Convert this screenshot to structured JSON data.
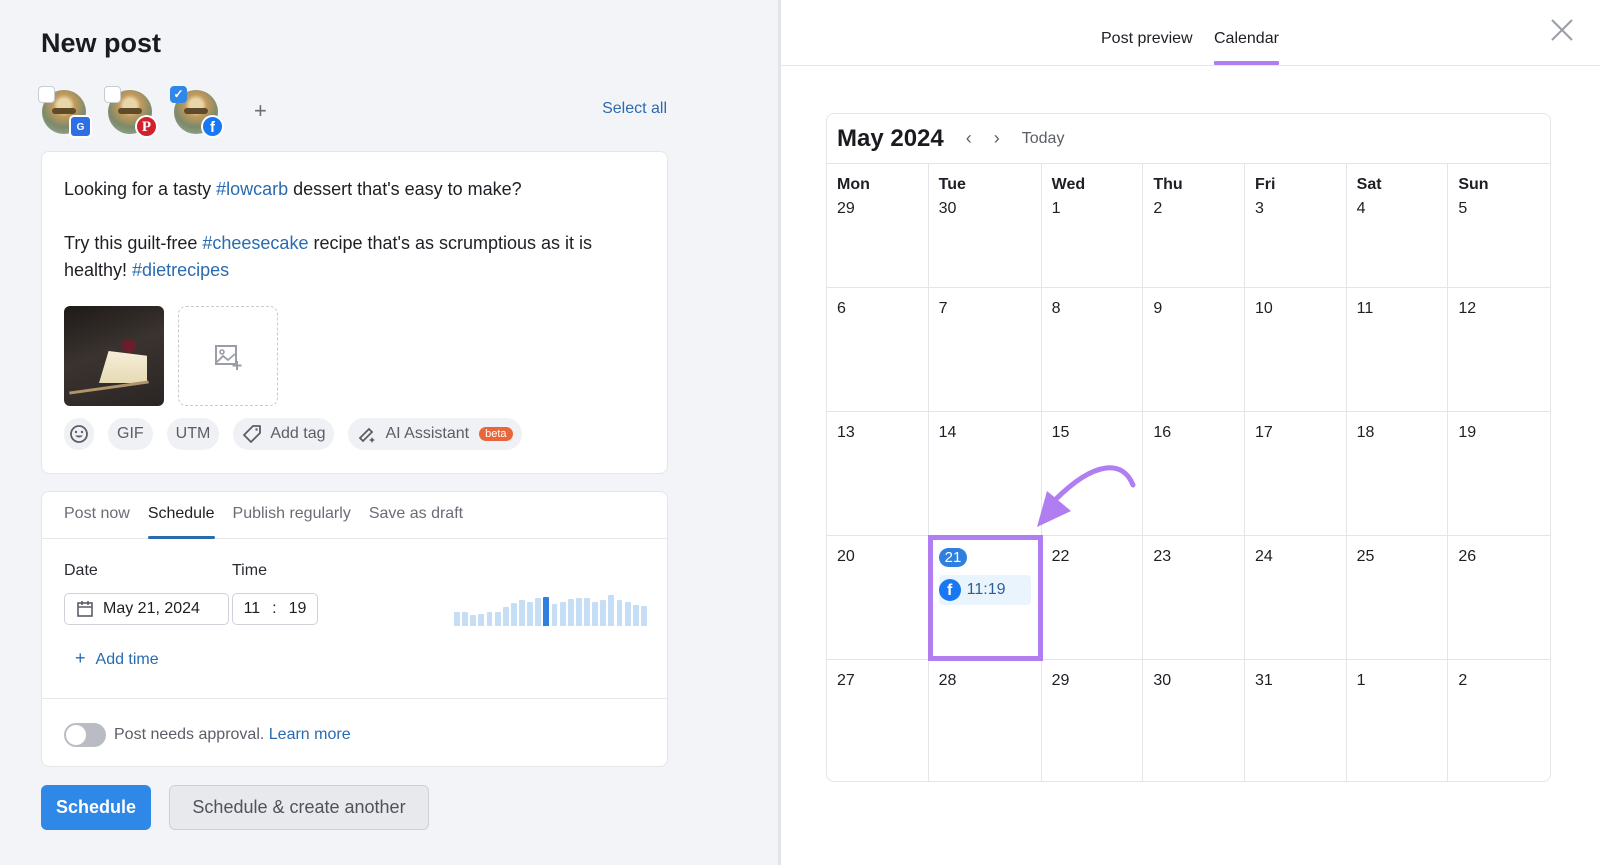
{
  "left": {
    "title": "New post",
    "accounts": [
      {
        "network": "google-business-profile",
        "checked": false,
        "badge": "G"
      },
      {
        "network": "pinterest",
        "checked": false,
        "badge": "P"
      },
      {
        "network": "facebook",
        "checked": true,
        "badge": "f"
      }
    ],
    "add_account": "+",
    "select_all": "Select all",
    "post": {
      "line1_before": "Looking for a tasty ",
      "line1_tag": "#lowcarb",
      "line1_after": " dessert that's easy to make?",
      "line2_before": "Try this guilt-free ",
      "line2_tag": "#cheesecake",
      "line2_after": " recipe that's as scrumptious as it is healthy! ",
      "line2_tag2": "#dietrecipes"
    },
    "tools": {
      "emoji": "emoji",
      "gif": "GIF",
      "utm": "UTM",
      "add_tag": "Add tag",
      "ai_assistant": "AI Assistant",
      "beta": "beta"
    },
    "schedule_tabs": [
      "Post now",
      "Schedule",
      "Publish regularly",
      "Save as draft"
    ],
    "active_tab": "Schedule",
    "date_label": "Date",
    "time_label": "Time",
    "date_value": "May 21, 2024",
    "time_hour": "11",
    "time_sep": ":",
    "time_minute": "19",
    "activity_bars": [
      0.45,
      0.45,
      0.35,
      0.38,
      0.45,
      0.45,
      0.6,
      0.72,
      0.82,
      0.75,
      0.88,
      0.92,
      0.7,
      0.75,
      0.85,
      0.88,
      0.88,
      0.75,
      0.82,
      0.98,
      0.82,
      0.75,
      0.65,
      0.62
    ],
    "activity_selected_index": 11,
    "add_time": "Add time",
    "approval_text": "Post needs approval.",
    "approval_link": "Learn more",
    "approval_on": false,
    "schedule_button": "Schedule",
    "schedule_another_button": "Schedule & create another"
  },
  "right": {
    "tabs": [
      "Post preview",
      "Calendar"
    ],
    "active_tab": "Calendar",
    "calendar": {
      "month": "May 2024",
      "prev": "‹",
      "next": "›",
      "today": "Today",
      "weekdays": [
        "Mon",
        "Tue",
        "Wed",
        "Thu",
        "Fri",
        "Sat",
        "Sun"
      ],
      "weeks": [
        [
          "29",
          "30",
          "1",
          "2",
          "3",
          "4",
          "5"
        ],
        [
          "6",
          "7",
          "8",
          "9",
          "10",
          "11",
          "12"
        ],
        [
          "13",
          "14",
          "15",
          "16",
          "17",
          "18",
          "19"
        ],
        [
          "20",
          "21",
          "22",
          "23",
          "24",
          "25",
          "26"
        ],
        [
          "27",
          "28",
          "29",
          "30",
          "31",
          "1",
          "2"
        ]
      ],
      "selected_day": "21",
      "event": {
        "network": "facebook",
        "time": "11:19"
      }
    }
  },
  "colors": {
    "accent_blue": "#2f87e8",
    "link_blue": "#2a6bb0",
    "highlight_purple": "#b07ef0",
    "beta_orange": "#e8663a"
  }
}
